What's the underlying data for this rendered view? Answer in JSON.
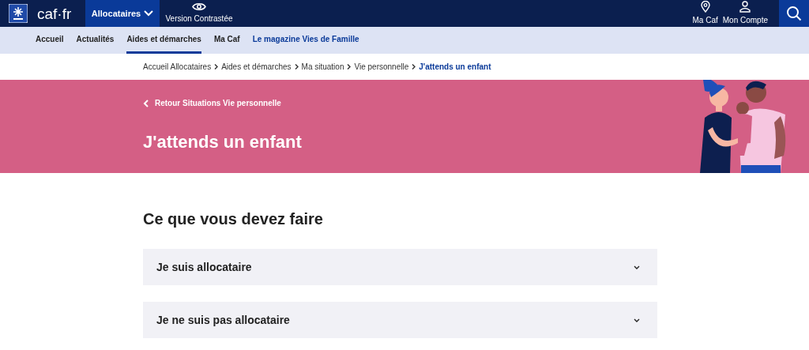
{
  "header": {
    "logo_text": "caf·fr",
    "menu_button": "Allocataires",
    "contrast_link": "Version Contrastée",
    "actions": [
      {
        "kind": "pin",
        "label": "Ma Caf"
      },
      {
        "kind": "user",
        "label": "Mon Compte"
      }
    ]
  },
  "nav": [
    {
      "label": "Accueil",
      "selected": false,
      "highlight": false
    },
    {
      "label": "Actualités",
      "selected": false,
      "highlight": false
    },
    {
      "label": "Aides et démarches",
      "selected": true,
      "highlight": false
    },
    {
      "label": "Ma Caf",
      "selected": false,
      "highlight": false
    },
    {
      "label": "Le magazine Vies de Famille",
      "selected": false,
      "highlight": true
    }
  ],
  "breadcrumb": [
    "Accueil Allocataires",
    "Aides et démarches",
    "Ma situation",
    "Vie personnelle",
    "J'attends un enfant"
  ],
  "banner": {
    "back_link": "Retour Situations Vie personnelle",
    "title": "J'attends un enfant"
  },
  "section_title": "Ce que vous devez faire",
  "accordions": [
    {
      "label": "Je suis allocataire",
      "expanded": false
    },
    {
      "label": "Je ne suis pas allocataire",
      "expanded": false
    }
  ]
}
